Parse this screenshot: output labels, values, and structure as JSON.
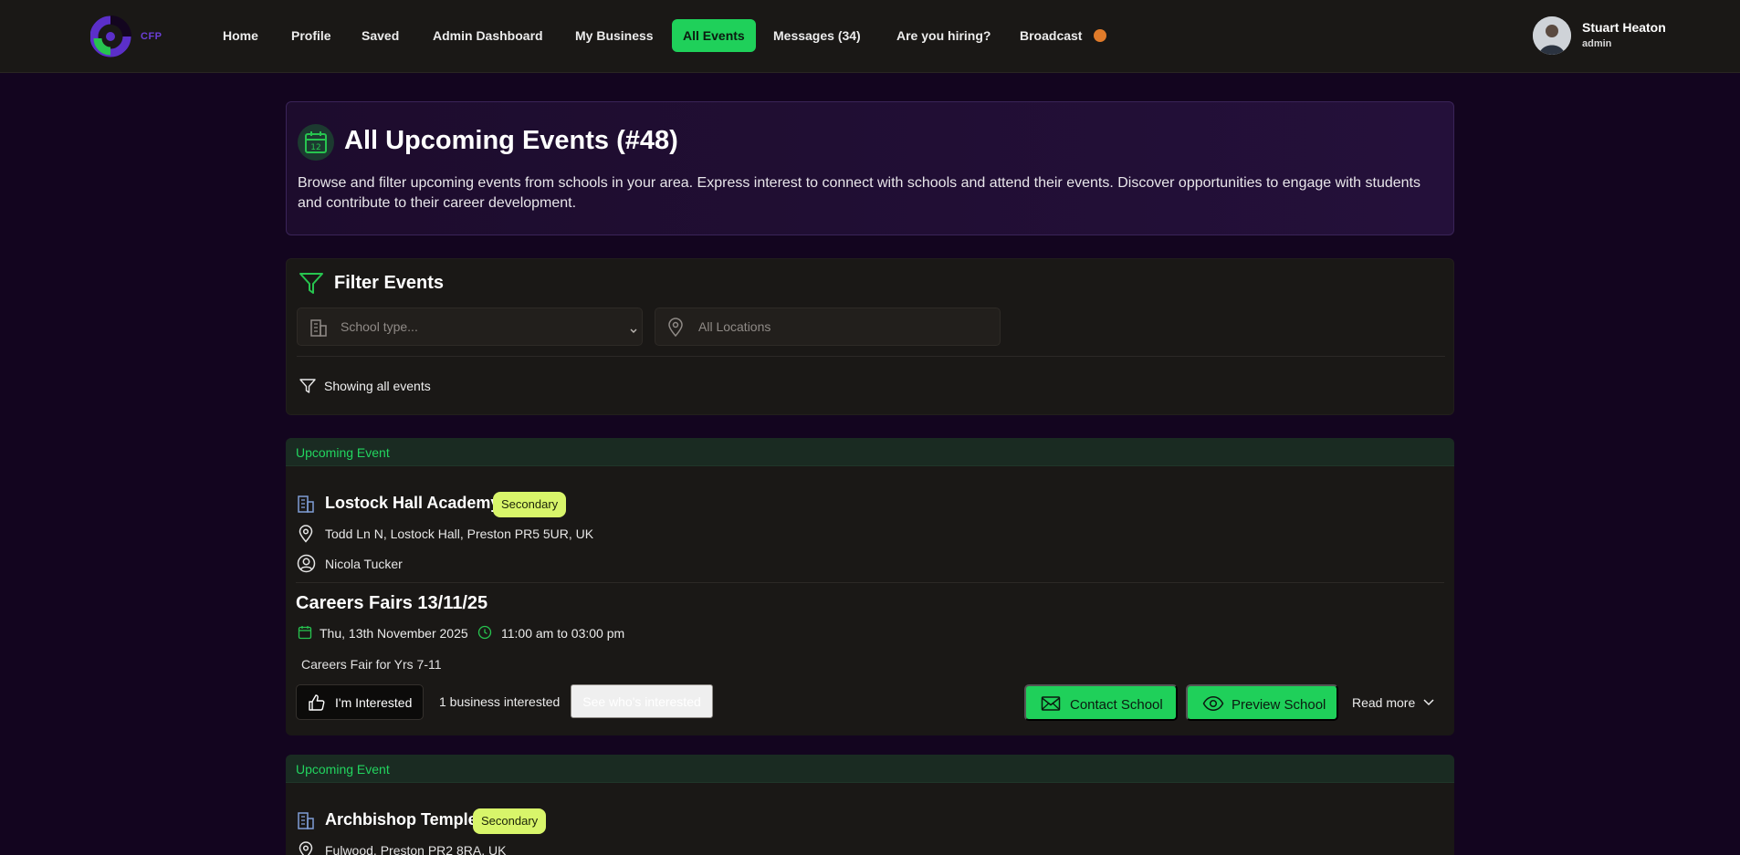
{
  "brand": {
    "logo_text": "CFP"
  },
  "nav": {
    "items": [
      {
        "label": "Home",
        "active": false
      },
      {
        "label": "Profile",
        "active": false
      },
      {
        "label": "Saved",
        "active": false
      },
      {
        "label": "Admin Dashboard",
        "active": false
      },
      {
        "label": "My Business",
        "active": false
      },
      {
        "label": "All Events",
        "active": true
      },
      {
        "label": "Messages (34)",
        "active": false
      },
      {
        "label": "Are you hiring?",
        "active": false
      },
      {
        "label": "Broadcast",
        "active": false
      }
    ],
    "broadcast_indicator_color": "#e07b2a"
  },
  "user": {
    "name": "Stuart Heaton",
    "role": "admin"
  },
  "hero": {
    "icon": "calendar-icon",
    "calendar_day": "12",
    "title": "All Upcoming Events (#48)",
    "description": "Browse and filter upcoming events from schools in your area. Express interest to connect with schools and attend their events. Discover opportunities to engage with students and contribute to their career development."
  },
  "filters": {
    "title": "Filter Events",
    "school_type_placeholder": "School type...",
    "location_placeholder": "All Locations",
    "status_text": "Showing all events"
  },
  "events": [
    {
      "band_label": "Upcoming Event",
      "school_name": "Lostock Hall Academy",
      "school_type": "Secondary",
      "address": "Todd Ln N, Lostock Hall, Preston PR5 5UR, UK",
      "contact": "Nicola Tucker",
      "title": "Careers Fairs 13/11/25",
      "date": "Thu, 13th November 2025",
      "time": "11:00 am to 03:00 pm",
      "description": "Careers Fair for Yrs 7-11",
      "interested_label": "I'm Interested",
      "interest_count": "1 business interested",
      "see_who_label": "See who's interested",
      "contact_label": "Contact School",
      "preview_label": "Preview School",
      "read_more_label": "Read more"
    },
    {
      "band_label": "Upcoming Event",
      "school_name": "Archbishop Temple",
      "school_type": "Secondary",
      "address": "Fulwood, Preston PR2 8RA, UK"
    }
  ],
  "colors": {
    "accent_green": "#1fd05a",
    "badge_lime": "#d8f56a",
    "page_bg": "#13051f",
    "card_bg": "#1a1816"
  }
}
